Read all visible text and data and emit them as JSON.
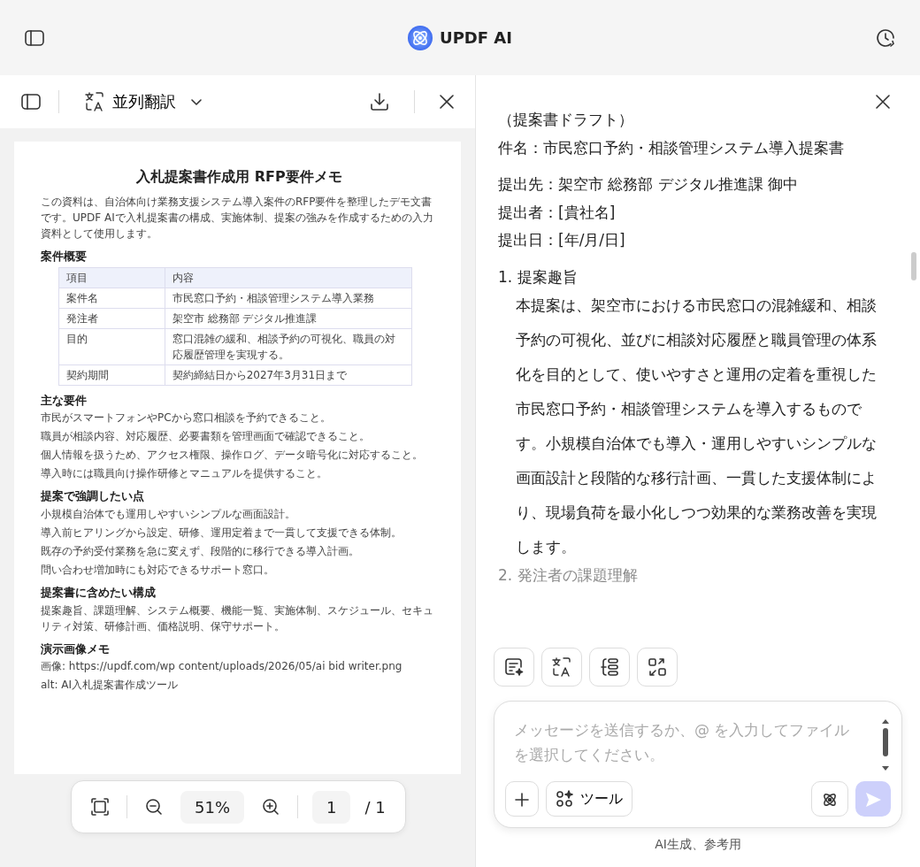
{
  "header": {
    "title": "UPDF AI"
  },
  "left_toolbar": {
    "mode": "並列翻訳"
  },
  "document": {
    "title": "入札提案書作成用 RFP要件メモ",
    "intro": "この資料は、自治体向け業務支援システム導入案件のRFP要件を整理したデモ文書です。UPDF AIで入札提案書の構成、実施体制、提案の強みを作成するための入力資料として使用します。",
    "sections": [
      {
        "kind": "table",
        "heading": "案件概要",
        "columns": [
          "項目",
          "内容"
        ],
        "rows": [
          [
            "案件名",
            "市民窓口予約・相談管理システム導入業務"
          ],
          [
            "発注者",
            "架空市 総務部 デジタル推進課"
          ],
          [
            "目的",
            "窓口混雑の緩和、相談予約の可視化、職員の対応履歴管理を実現する。"
          ],
          [
            "契約期間",
            "契約締結日から2027年3月31日まで"
          ]
        ]
      },
      {
        "kind": "lines",
        "heading": "主な要件",
        "lines": [
          "市民がスマートフォンやPCから窓口相談を予約できること。",
          "職員が相談内容、対応履歴、必要書類を管理画面で確認できること。",
          "個人情報を扱うため、アクセス権限、操作ログ、データ暗号化に対応すること。",
          "導入時には職員向け操作研修とマニュアルを提供すること。"
        ]
      },
      {
        "kind": "lines",
        "heading": "提案で強調したい点",
        "lines": [
          "小規模自治体でも運用しやすいシンプルな画面設計。",
          "導入前ヒアリングから設定、研修、運用定着まで一貫して支援できる体制。",
          "既存の予約受付業務を急に変えず、段階的に移行できる導入計画。",
          "問い合わせ増加時にも対応できるサポート窓口。"
        ]
      },
      {
        "kind": "lines",
        "heading": "提案書に含めたい構成",
        "lines": [
          "提案趣旨、課題理解、システム概要、機能一覧、実施体制、スケジュール、セキュリティ対策、研修計画、価格説明、保守サポート。"
        ]
      },
      {
        "kind": "lines",
        "heading": "演示画像メモ",
        "lines": [
          "画像: https://updf.com/wp content/uploads/2026/05/ai bid writer.png",
          "alt: AI入札提案書作成ツール"
        ]
      }
    ]
  },
  "zoom_bar": {
    "zoom": "51%",
    "page": "1",
    "total": "/ 1"
  },
  "answer": {
    "lines": [
      "（提案書ドラフト）",
      "件名：市民窓口予約・相談管理システム導入提案書",
      "提出先：架空市 総務部 デジタル推進課 御中",
      "提出者：[貴社名]",
      "提出日：[年/月/日]"
    ],
    "items": [
      {
        "number": "1.",
        "title": "提案趣旨",
        "body": "本提案は、架空市における市民窓口の混雑緩和、相談予約の可視化、並びに相談対応履歴と職員管理の体系化を目的として、使いやすさと運用の定着を重視した市民窓口予約・相談管理システムを導入するものです。小規模自治体でも導入・運用しやすいシンプルな画面設計と段階的な移行計画、一貫した支援体制により、現場負荷を最小化しつつ効果的な業務改善を実現します。",
        "faded": false
      },
      {
        "number": "2.",
        "title": "発注者の課題理解",
        "faded": true
      }
    ]
  },
  "composer": {
    "placeholder": "メッセージを送信するか、@ を入力してファイルを選択してください。",
    "tools_label": "ツール",
    "send_enabled": false
  },
  "footer_note": "AI生成、参考用"
}
